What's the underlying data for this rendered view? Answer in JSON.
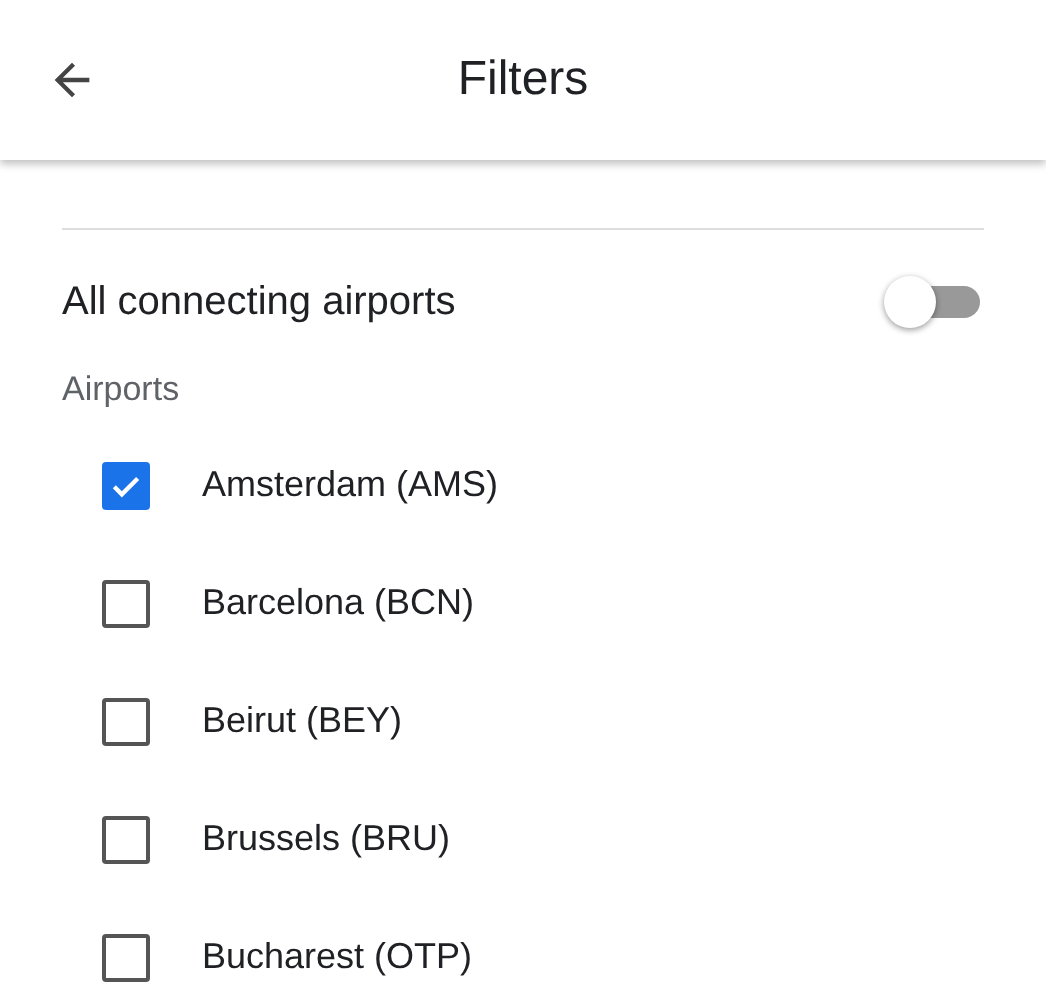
{
  "header": {
    "title": "Filters"
  },
  "connecting": {
    "label": "All connecting airports",
    "on": false
  },
  "section": "Airports",
  "airports": [
    {
      "label": "Amsterdam (AMS)",
      "checked": true
    },
    {
      "label": "Barcelona (BCN)",
      "checked": false
    },
    {
      "label": "Beirut (BEY)",
      "checked": false
    },
    {
      "label": "Brussels (BRU)",
      "checked": false
    },
    {
      "label": "Bucharest (OTP)",
      "checked": false
    }
  ]
}
